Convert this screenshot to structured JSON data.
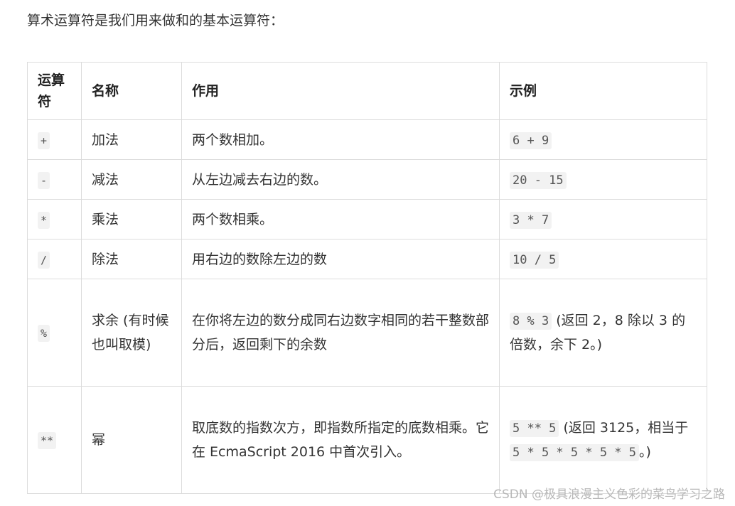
{
  "intro": "算术运算符是我们用来做和的基本运算符：",
  "table": {
    "headers": [
      "运算符",
      "名称",
      "作用",
      "示例"
    ],
    "rows": [
      {
        "op": "+",
        "name": "加法",
        "desc": "两个数相加。",
        "example_code": "6 + 9",
        "example_text": ""
      },
      {
        "op": "-",
        "name": "减法",
        "desc": "从左边减去右边的数。",
        "example_code": "20 - 15",
        "example_text": ""
      },
      {
        "op": "*",
        "name": "乘法",
        "desc": "两个数相乘。",
        "example_code": "3 * 7",
        "example_text": ""
      },
      {
        "op": "/",
        "name": "除法",
        "desc": "用右边的数除左边的数",
        "example_code": "10 / 5",
        "example_text": ""
      },
      {
        "op": "%",
        "name": "求余 (有时候也叫取模)",
        "desc": "在你将左边的数分成同右边数字相同的若干整数部分后，返回剩下的余数",
        "example_code": "8 % 3",
        "example_text": " (返回 2，8 除以 3 的倍数，余下 2。)"
      },
      {
        "op": "**",
        "name": "幂",
        "desc": "取底数的指数次方，即指数所指定的底数相乘。它在 EcmaScript 2016 中首次引入。",
        "example_code": "5 ** 5",
        "example_text": " (返回 3125，相当于 ",
        "example_code2": "5 * 5 * 5 * 5 * 5",
        "example_text2": "。)"
      }
    ]
  },
  "watermark": "CSDN @极具浪漫主义色彩的菜鸟学习之路"
}
